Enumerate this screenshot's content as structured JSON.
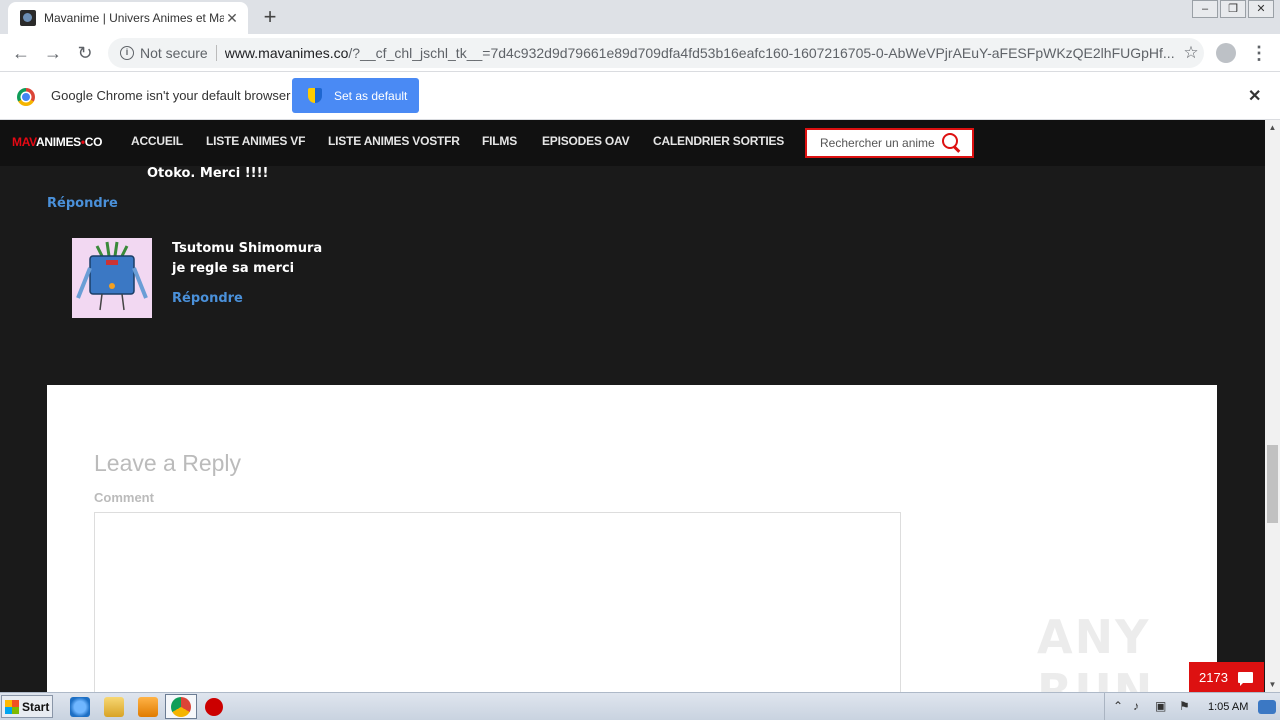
{
  "browser": {
    "tab_title": "Mavanime | Univers Animes et Mangas",
    "new_tab_symbol": "+",
    "not_secure": "Not secure",
    "url_host": "www.mavanimes.co",
    "url_path": "/?__cf_chl_jschl_tk__=7d4c932d9d79661e89d709dfa4fd53b16eafc160-1607216705-0-AbWeVPjrAEuY-aFESFpWKzQE2lhFUGpHf...",
    "infobar_text": "Google Chrome isn't your default browser",
    "set_default_label": "Set as default"
  },
  "site": {
    "logo_red": "MAV",
    "logo_white": "ANIMES",
    "logo_dot": "•",
    "logo_tld": "CO",
    "nav": [
      "ACCUEIL",
      "LISTE ANIMES VF",
      "LISTE ANIMES VOSTFR",
      "FILMS",
      "EPISODES OAV",
      "CALENDRIER SORTIES"
    ],
    "search_placeholder": "Rechercher un anime"
  },
  "comments": {
    "first_text_tail": "Otoko. Merci !!!!",
    "reply_label": "Répondre",
    "second_author": "Tsutomu Shimomura",
    "second_text": "je regle sa merci"
  },
  "reply_form": {
    "title": "Leave a Reply",
    "comment_label": "Comment"
  },
  "overlay": {
    "watermark": "ANY RUN",
    "counter": "2173"
  },
  "taskbar": {
    "start_label": "Start",
    "clock": "1:05 AM"
  },
  "colors": {
    "site_bg": "#1a1a1a",
    "accent_red": "#e50914",
    "link_blue": "#4a90d9",
    "chrome_button_blue": "#4a8af4"
  }
}
